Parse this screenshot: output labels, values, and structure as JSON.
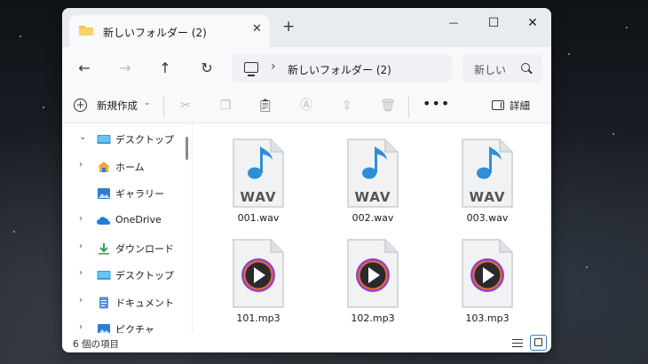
{
  "window": {
    "tab_title": "新しいフォルダー (2)",
    "tab_close": "✕",
    "new_tab": "+",
    "minimize": "—",
    "maximize": "☐",
    "close": "✕"
  },
  "nav": {
    "back": "←",
    "forward": "→",
    "up": "↑",
    "refresh": "↻",
    "path_chevron": "›",
    "path": "新しいフォルダー (2)",
    "search_placeholder": "新しい"
  },
  "toolbar": {
    "new_label": "新規作成",
    "new_caret": "⌄",
    "more": "•••",
    "details_label": "詳細",
    "icons": [
      "cut-icon",
      "copy-icon",
      "paste-icon",
      "rename-icon",
      "share-icon",
      "delete-icon"
    ]
  },
  "sidebar": {
    "items": [
      {
        "label": "デスクトップ",
        "arrow": "⌄",
        "icon": "desktop-icon"
      },
      {
        "label": "ホーム",
        "arrow": "›",
        "icon": "home-icon"
      },
      {
        "label": "ギャラリー",
        "arrow": "",
        "icon": "gallery-icon"
      },
      {
        "label": "OneDrive",
        "arrow": "›",
        "icon": "onedrive-icon"
      },
      {
        "label": "ダウンロード",
        "arrow": "›",
        "icon": "download-icon"
      },
      {
        "label": "デスクトップ",
        "arrow": "›",
        "icon": "desktop-icon"
      },
      {
        "label": "ドキュメント",
        "arrow": "›",
        "icon": "documents-icon"
      },
      {
        "label": "ピクチャ",
        "arrow": "›",
        "icon": "pictures-icon"
      }
    ]
  },
  "files": [
    {
      "name": "001.wav",
      "type": "wav",
      "badge": "WAV"
    },
    {
      "name": "002.wav",
      "type": "wav",
      "badge": "WAV"
    },
    {
      "name": "003.wav",
      "type": "wav",
      "badge": "WAV"
    },
    {
      "name": "101.mp3",
      "type": "mp3"
    },
    {
      "name": "102.mp3",
      "type": "mp3"
    },
    {
      "name": "103.mp3",
      "type": "mp3"
    }
  ],
  "status": {
    "item_count": "6 個の項目"
  },
  "colors": {
    "accent": "#3b82c4",
    "folder": "#f4c542",
    "note": "#2e8fd6",
    "play_ring": "#8e44c9"
  }
}
